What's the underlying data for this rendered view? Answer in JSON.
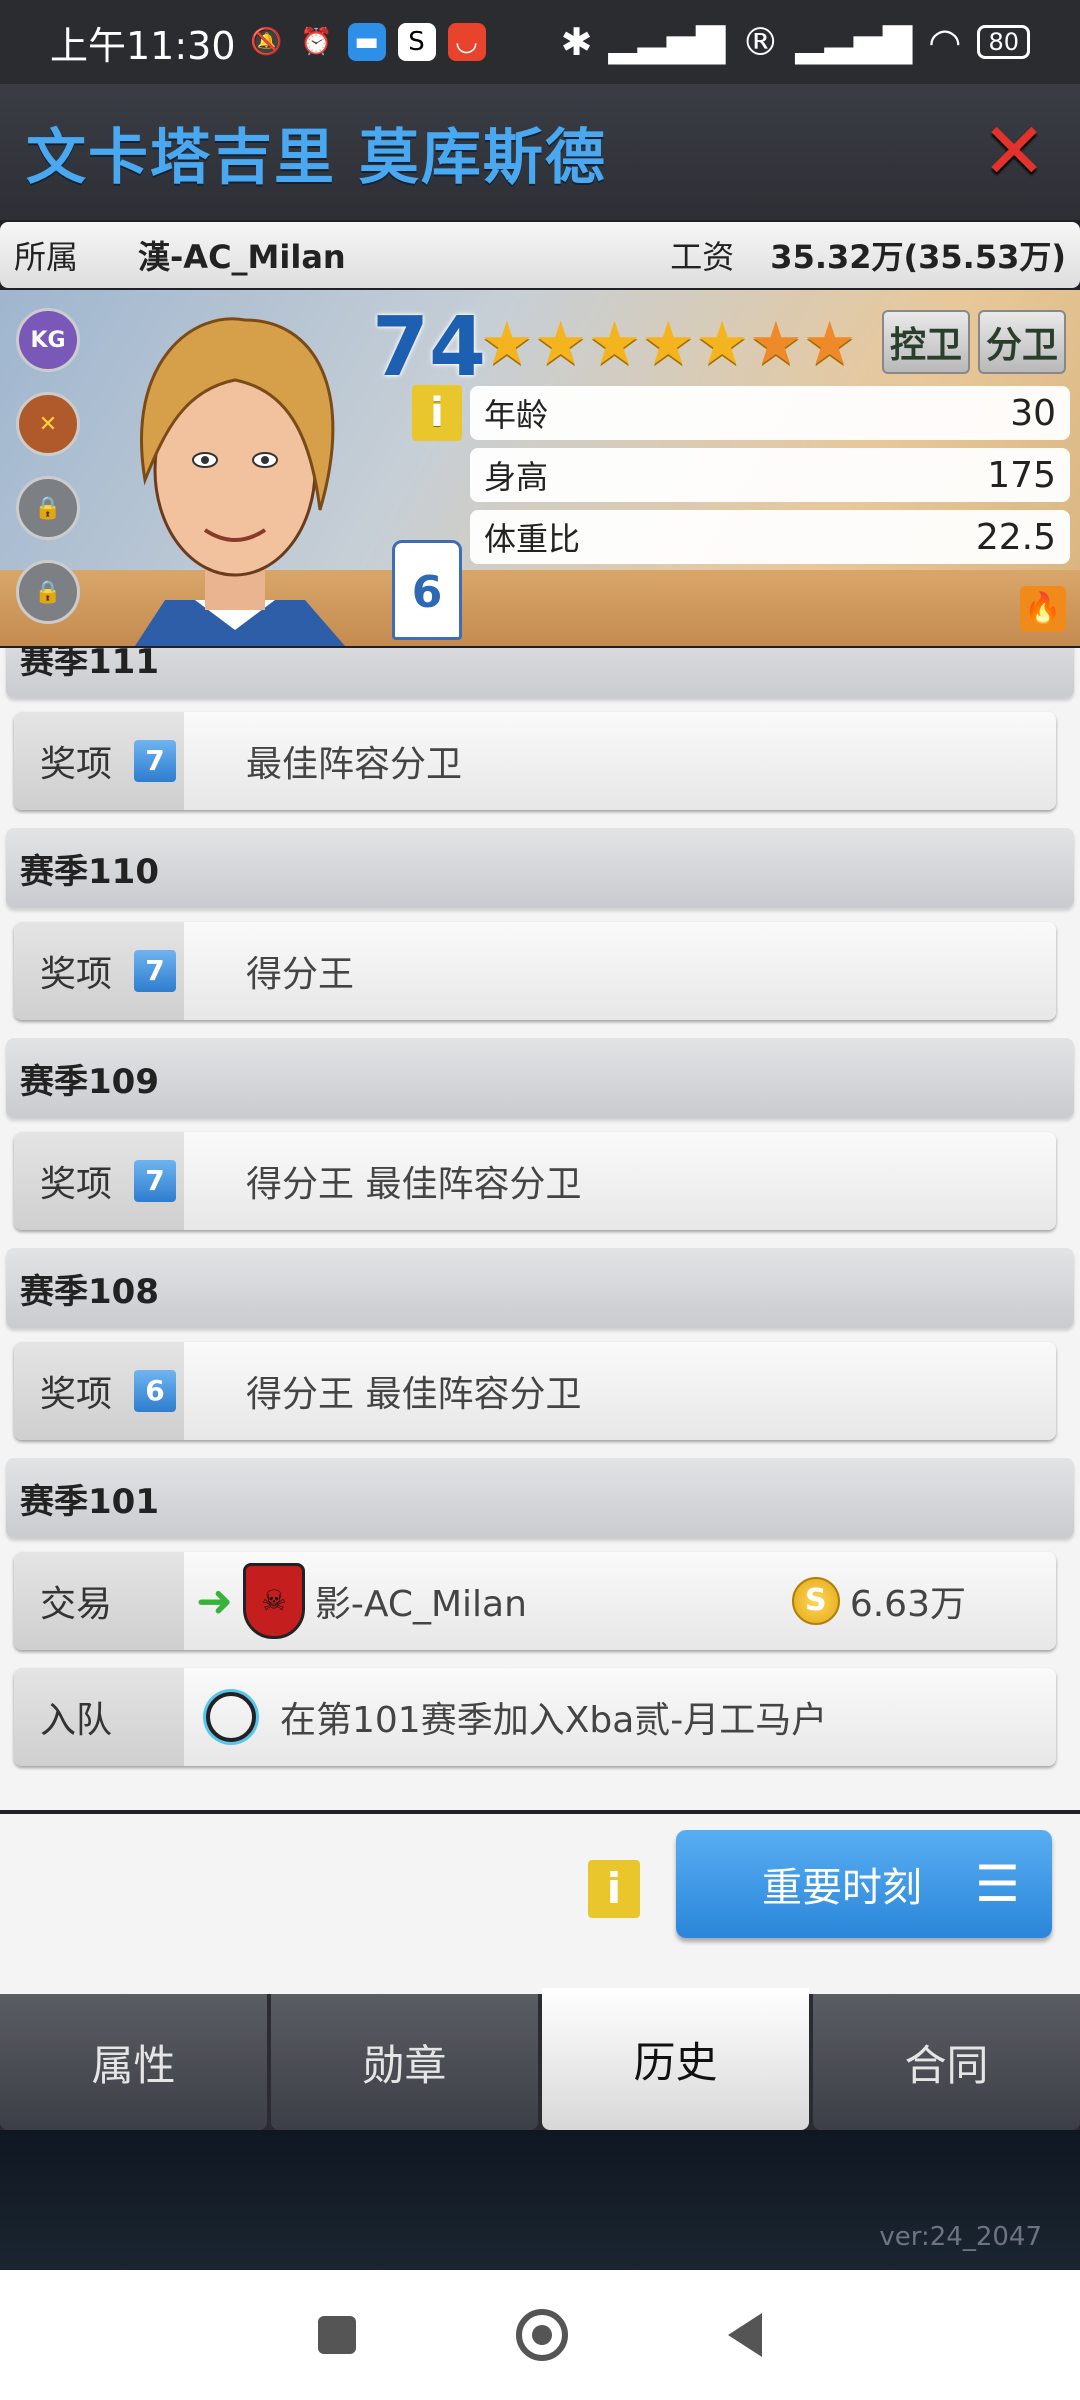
{
  "status_bar": {
    "time": "上午11:30",
    "battery": "80"
  },
  "header": {
    "title": "文卡塔吉里 莫库斯德",
    "close_glyph": "✕"
  },
  "info": {
    "team_label": "所属",
    "team_value": "漢-AC_Milan",
    "salary_label": "工资",
    "salary_value": "35.32万(35.53万)"
  },
  "player": {
    "rating": "74",
    "stars": 5.5,
    "positions": [
      "控卫",
      "分卫"
    ],
    "jersey": "6",
    "info_glyph": "i",
    "stats": [
      {
        "label": "年龄",
        "value": "30"
      },
      {
        "label": "身高",
        "value": "175"
      },
      {
        "label": "体重比",
        "value": "22.5"
      }
    ]
  },
  "history": {
    "partial_season": "赛季111",
    "award_label": "奖项",
    "seasons": [
      {
        "season": "赛季111",
        "level": "7",
        "awards": "最佳阵容分卫"
      },
      {
        "season": "赛季110",
        "level": "7",
        "awards": "得分王"
      },
      {
        "season": "赛季109",
        "level": "7",
        "awards": "得分王  最佳阵容分卫"
      },
      {
        "season": "赛季108",
        "level": "6",
        "awards": "得分王  最佳阵容分卫"
      }
    ],
    "season_101": "赛季101",
    "trade": {
      "label": "交易",
      "team": "影-AC_Milan",
      "amount": "6.63万"
    },
    "join": {
      "label": "入队",
      "text": "在第101赛季加入Xba贰-月工马户"
    }
  },
  "actions": {
    "info_glyph": "i",
    "moments_label": "重要时刻"
  },
  "tabs": [
    {
      "label": "属性",
      "active": false
    },
    {
      "label": "勋章",
      "active": false
    },
    {
      "label": "历史",
      "active": true
    },
    {
      "label": "合同",
      "active": false
    }
  ],
  "version": "ver:24_2047"
}
